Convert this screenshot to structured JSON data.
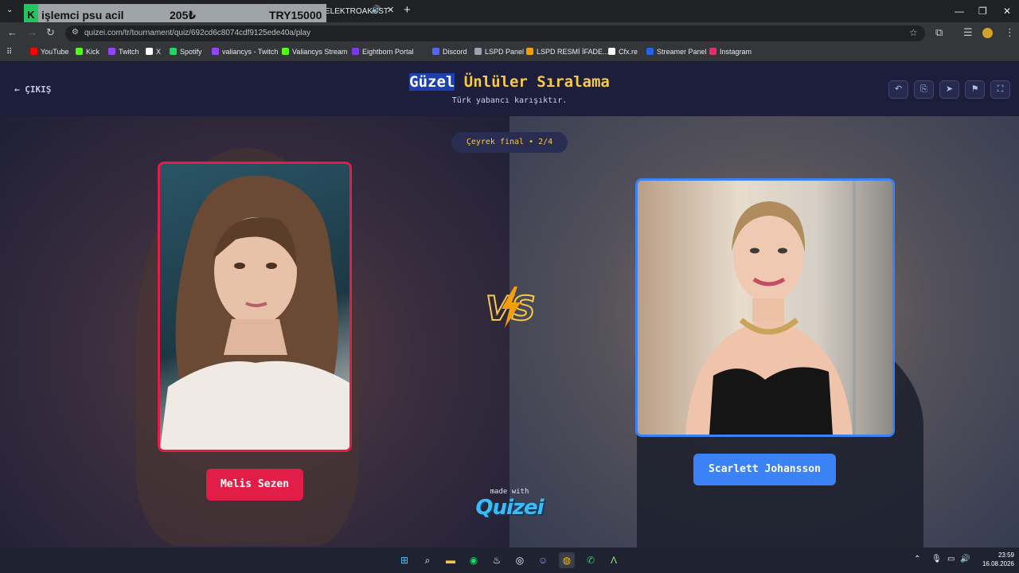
{
  "browser": {
    "overlay": {
      "badge": "K",
      "text1": "işlemci psu acil",
      "text2": "205₺",
      "text3": "TRY15000"
    },
    "tab_label": "ELEKTROAKUST",
    "url": "quizei.com/tr/tournament/quiz/692cd6c8074cdf9125ede40a/play",
    "bookmarks": [
      {
        "label": "YouTube",
        "color": "#ff0000"
      },
      {
        "label": "Kick",
        "color": "#53fc18"
      },
      {
        "label": "Twitch",
        "color": "#9146ff"
      },
      {
        "label": "X",
        "color": "#ffffff"
      },
      {
        "label": "Spotify",
        "color": "#1ed760"
      },
      {
        "label": "valiancys - Twitch",
        "color": "#9146ff"
      },
      {
        "label": "Valiancys Stream",
        "color": "#53fc18"
      },
      {
        "label": "Eightborn Portal",
        "color": "#7c3aed"
      },
      {
        "label": "Discord",
        "color": "#5865f2"
      },
      {
        "label": "LSPD Panel",
        "color": "#9ca3af"
      },
      {
        "label": "LSPD  RESMİ İFADE...",
        "color": "#f59e0b"
      },
      {
        "label": "Cfx.re",
        "color": "#ffffff"
      },
      {
        "label": "Streamer Panel",
        "color": "#2563eb"
      },
      {
        "label": "Instagram",
        "color": "#e1306c"
      }
    ]
  },
  "header": {
    "exit_label": "ÇIKIŞ",
    "title_hl": "Güzel",
    "title_rest": " Ünlüler Sıralama",
    "subtitle": "Türk yabancı karışıktır."
  },
  "main": {
    "stage": "Çeyrek final • 2/4",
    "left": {
      "name": "Melis Sezen",
      "color": "#e11d48"
    },
    "right": {
      "name": "Scarlett Johansson",
      "color": "#3b82f6"
    },
    "made_with": "made with",
    "logo": "Quizei"
  },
  "taskbar": {
    "time": "23:59",
    "date": "16.08.2026"
  }
}
